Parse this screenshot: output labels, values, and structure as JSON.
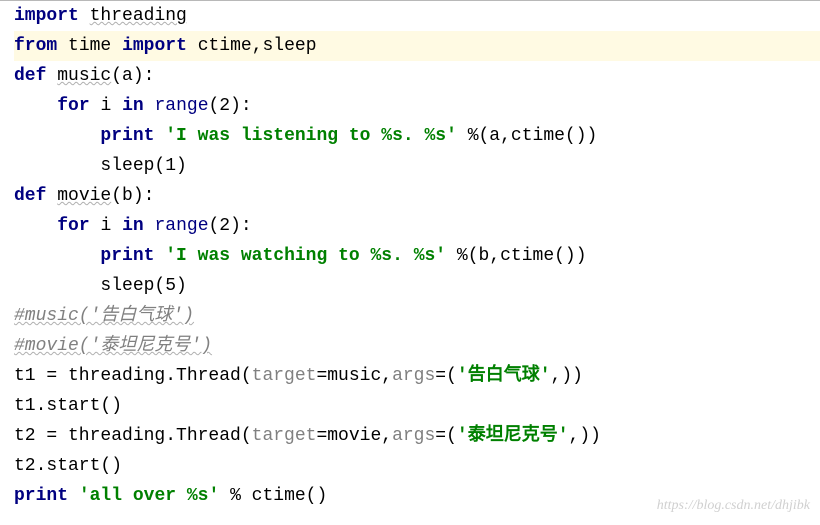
{
  "code": {
    "l1": {
      "kw_import": "import",
      "mod": "threading"
    },
    "l2": {
      "kw_from": "from",
      "mod": "time",
      "kw_import": "import",
      "names": "ctime,sleep"
    },
    "l3": {
      "kw_def": "def",
      "name": "music",
      "params": "(a):"
    },
    "l4": {
      "indent": "    ",
      "kw_for": "for",
      "var": "i",
      "kw_in": "in",
      "rng": "range",
      "args": "(2):"
    },
    "l5": {
      "indent": "        ",
      "kw_print": "print",
      "str": "'I was listening to %s. %s'",
      "tail": " %(a,ctime())"
    },
    "l6": {
      "indent": "        ",
      "call": "sleep(1)"
    },
    "l7": {
      "kw_def": "def",
      "name": "movie",
      "params": "(b):"
    },
    "l8": {
      "indent": "    ",
      "kw_for": "for",
      "var": "i",
      "kw_in": "in",
      "rng": "range",
      "args": "(2):"
    },
    "l9": {
      "indent": "        ",
      "kw_print": "print",
      "str": "'I was watching to %s. %s'",
      "tail": " %(b,ctime())"
    },
    "l10": {
      "indent": "        ",
      "call": "sleep(5)"
    },
    "l11": {
      "cmt": "#music('告白气球')"
    },
    "l12": {
      "cmt": "#movie('泰坦尼克号')"
    },
    "l13": {
      "pre": "t1 = threading.Thread(",
      "p1": "target",
      "eq1": "=music,",
      "p2": "args",
      "eq2": "=(",
      "str": "'告白气球'",
      "post": ",))"
    },
    "l14": {
      "txt": "t1.start()"
    },
    "l15": {
      "pre": "t2 = threading.Thread(",
      "p1": "target",
      "eq1": "=movie,",
      "p2": "args",
      "eq2": "=(",
      "str": "'泰坦尼克号'",
      "post": ",))"
    },
    "l16": {
      "txt": "t2.start()"
    },
    "l17": {
      "kw_print": "print",
      "str": "'all over %s'",
      "tail": " % ctime()"
    }
  },
  "watermark": "https://blog.csdn.net/dhjibk"
}
